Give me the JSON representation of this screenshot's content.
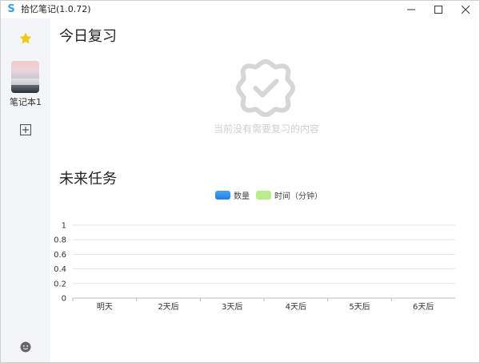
{
  "window": {
    "title": "拾忆笔记(1.0.72)",
    "logo_letter": "S",
    "controls": [
      "minimize-icon",
      "maximize-icon",
      "close-icon"
    ]
  },
  "sidebar": {
    "favorites_icon": "star-icon",
    "notebooks": [
      {
        "label": "笔记本1"
      }
    ],
    "add_icon": "add-square-icon",
    "footer_icon": "smile-icon"
  },
  "today": {
    "title": "今日复习",
    "empty_icon": "check-flower-icon",
    "empty_text": "当前没有需要复习的内容"
  },
  "future": {
    "title": "未来任务"
  },
  "colors": {
    "accent_blue": "#2a8ae6",
    "legend_green": "#b9ec8c",
    "star": "#f5c518",
    "empty_gray": "#d0d0d0"
  },
  "chart_data": {
    "type": "bar",
    "categories": [
      "明天",
      "2天后",
      "3天后",
      "4天后",
      "5天后",
      "6天后"
    ],
    "series": [
      {
        "name": "数量",
        "values": [
          0,
          0,
          0,
          0,
          0,
          0
        ],
        "color": "#2a8ae6"
      },
      {
        "name": "时间（分钟）",
        "values": [
          0,
          0,
          0,
          0,
          0,
          0
        ],
        "color": "#b9ec8c"
      }
    ],
    "yticks": [
      "0",
      "0.2",
      "0.4",
      "0.6",
      "0.8",
      "1"
    ],
    "ylim": [
      0,
      1
    ],
    "grid": true,
    "legend": "top-center"
  }
}
